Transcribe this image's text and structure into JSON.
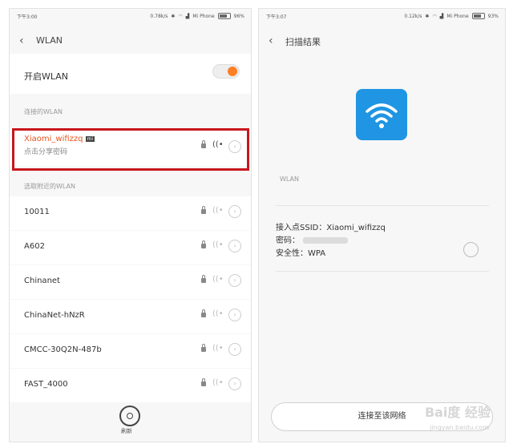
{
  "left": {
    "status": {
      "time": "下午3:00",
      "speed": "0.78k/s",
      "carrier": "Mi Phone",
      "battery": "96%"
    },
    "title": "WLAN",
    "toggle_label": "开启WLAN",
    "toggle_on": true,
    "accent_color": "#ff7f24",
    "connected_section": "连接的WLAN",
    "selected_network": {
      "name": "Xiaomi_wifizzq",
      "badge": "mi",
      "sub": "点击分享密码"
    },
    "nearby_section": "选取附近的WLAN",
    "networks": [
      {
        "name": "10011"
      },
      {
        "name": "A602"
      },
      {
        "name": "Chinanet"
      },
      {
        "name": "ChinaNet-hNzR"
      },
      {
        "name": "CMCC-30Q2N-487b"
      },
      {
        "name": "FAST_4000"
      }
    ],
    "refresh_label": "刷新",
    "highlight_color": "#c8171d"
  },
  "right": {
    "status": {
      "time": "下午3:07",
      "speed": "0.12k/s",
      "carrier": "Mi Phone",
      "battery": "93%"
    },
    "title": "扫描结果",
    "section_label": "WLAN",
    "ssid_line": "接入点SSID：Xiaomi_wifizzq",
    "password_label": "密码：",
    "security_line": "安全性：WPA",
    "connect_button": "连接至该网络",
    "icon_color": "#1f95e3",
    "watermark": "Bai度 经验",
    "watermark_sub": "jingyan.baidu.com"
  }
}
